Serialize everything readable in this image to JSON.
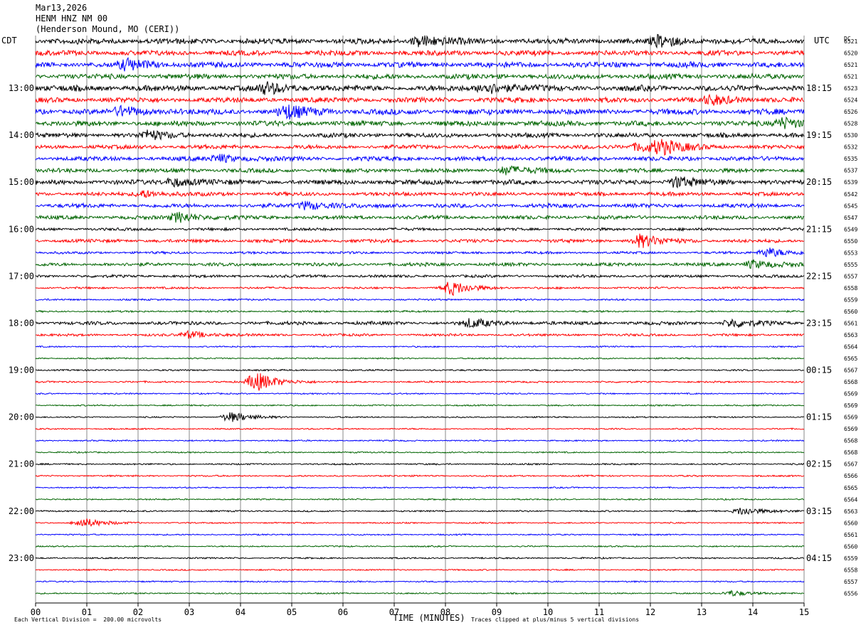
{
  "header": {
    "date": "Mar13,2026",
    "station": "HENM HNZ NM 00",
    "location": "(Henderson Mound, MO (CERI))"
  },
  "left_zone_label": "CDT",
  "right_zone_label": "UTC",
  "dc_label": "DC",
  "footer": {
    "scale_note": "Each Vertical Division =  200.00 microvolts",
    "clip_note": "Traces clipped at plus/minus 5 vertical divisions"
  },
  "colors": [
    "#000000",
    "#ff0000",
    "#0000ff",
    "#006400"
  ],
  "chart_data": {
    "type": "line",
    "xlabel": "TIME (MINUTES)",
    "xlim": [
      0,
      15
    ],
    "x_ticks": [
      "00",
      "01",
      "02",
      "03",
      "04",
      "05",
      "06",
      "07",
      "08",
      "09",
      "10",
      "11",
      "12",
      "13",
      "14",
      "15"
    ],
    "left_hour_labels": [
      "13:00",
      "14:00",
      "15:00",
      "16:00",
      "17:00",
      "18:00",
      "19:00",
      "20:00",
      "21:00",
      "22:00",
      "23:00"
    ],
    "right_hour_labels": [
      "18:15",
      "19:15",
      "20:15",
      "21:15",
      "22:15",
      "23:15",
      "00:15",
      "01:15",
      "02:15",
      "03:15",
      "04:15"
    ],
    "trace_count": 48,
    "dc_values": [
      "6521",
      "6520",
      "6521",
      "6521",
      "6523",
      "6524",
      "6526",
      "6528",
      "6530",
      "6532",
      "6535",
      "6537",
      "6539",
      "6542",
      "6545",
      "6547",
      "6549",
      "6550",
      "6553",
      "6555",
      "6557",
      "6558",
      "6559",
      "6560",
      "6561",
      "6563",
      "6564",
      "6565",
      "6567",
      "6568",
      "6569",
      "6569",
      "6569",
      "6569",
      "6568",
      "6568",
      "6567",
      "6566",
      "6565",
      "6564",
      "6563",
      "6560",
      "6561",
      "6560",
      "6559",
      "6558",
      "6557",
      "6556"
    ],
    "noise_levels": [
      3.2,
      3.0,
      3.2,
      3.0,
      3.4,
      3.0,
      3.3,
      3.0,
      2.6,
      2.4,
      2.6,
      2.4,
      2.8,
      2.2,
      2.4,
      2.2,
      1.6,
      2.0,
      1.4,
      2.0,
      1.6,
      1.2,
      1.0,
      1.0,
      2.0,
      1.4,
      0.8,
      0.8,
      0.9,
      1.0,
      0.8,
      0.8,
      0.8,
      0.8,
      0.8,
      0.8,
      0.9,
      0.9,
      0.8,
      0.8,
      0.9,
      0.8,
      0.8,
      0.8,
      0.9,
      0.8,
      0.8,
      0.8
    ],
    "events": [
      {
        "trace": 0,
        "minute": 7.5,
        "amp": 8
      },
      {
        "trace": 0,
        "minute": 12.2,
        "amp": 8
      },
      {
        "trace": 2,
        "minute": 1.8,
        "amp": 7
      },
      {
        "trace": 4,
        "minute": 4.5,
        "amp": 7
      },
      {
        "trace": 4,
        "minute": 8.8,
        "amp": 8
      },
      {
        "trace": 5,
        "minute": 13.2,
        "amp": 6
      },
      {
        "trace": 6,
        "minute": 4.9,
        "amp": 9
      },
      {
        "trace": 6,
        "minute": 1.7,
        "amp": 6
      },
      {
        "trace": 7,
        "minute": 14.6,
        "amp": 8
      },
      {
        "trace": 8,
        "minute": 2.2,
        "amp": 6
      },
      {
        "trace": 9,
        "minute": 12.2,
        "amp": 9
      },
      {
        "trace": 9,
        "minute": 11.8,
        "amp": 7
      },
      {
        "trace": 10,
        "minute": 3.6,
        "amp": 5
      },
      {
        "trace": 11,
        "minute": 9.2,
        "amp": 6
      },
      {
        "trace": 12,
        "minute": 12.5,
        "amp": 7
      },
      {
        "trace": 12,
        "minute": 2.7,
        "amp": 6
      },
      {
        "trace": 13,
        "minute": 2.1,
        "amp": 5
      },
      {
        "trace": 14,
        "minute": 5.3,
        "amp": 6
      },
      {
        "trace": 15,
        "minute": 2.8,
        "amp": 7
      },
      {
        "trace": 17,
        "minute": 11.8,
        "amp": 9
      },
      {
        "trace": 18,
        "minute": 14.3,
        "amp": 7
      },
      {
        "trace": 19,
        "minute": 14.0,
        "amp": 6
      },
      {
        "trace": 21,
        "minute": 8.1,
        "amp": 10
      },
      {
        "trace": 24,
        "minute": 8.5,
        "amp": 6
      },
      {
        "trace": 24,
        "minute": 13.6,
        "amp": 6
      },
      {
        "trace": 25,
        "minute": 3.0,
        "amp": 5
      },
      {
        "trace": 29,
        "minute": 4.3,
        "amp": 14
      },
      {
        "trace": 32,
        "minute": 3.8,
        "amp": 7
      },
      {
        "trace": 40,
        "minute": 13.8,
        "amp": 6
      },
      {
        "trace": 41,
        "minute": 0.9,
        "amp": 7
      },
      {
        "trace": 47,
        "minute": 13.6,
        "amp": 4
      }
    ]
  }
}
